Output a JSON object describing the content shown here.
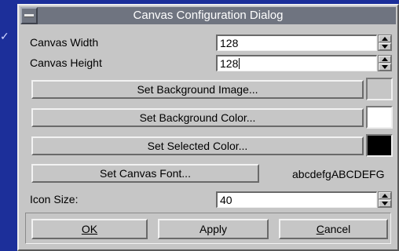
{
  "dialog": {
    "title": "Canvas Configuration Dialog"
  },
  "fields": {
    "width": {
      "label": "Canvas Width",
      "value": "128"
    },
    "height": {
      "label": "Canvas Height",
      "value": "128"
    },
    "icon_size": {
      "label": "Icon Size:",
      "value": "40"
    }
  },
  "buttons": {
    "background_image": "Set Background Image...",
    "background_color": "Set Background Color...",
    "selected_color": "Set Selected Color...",
    "canvas_font": "Set Canvas Font...",
    "ok": "OK",
    "apply": "Apply",
    "cancel": "Cancel"
  },
  "swatches": {
    "background_image": "#c6c6c6",
    "background_color": "#ffffff",
    "selected_color": "#000000"
  },
  "font_sample": "abcdefgABCDEFG",
  "colors": {
    "desktop": "#1c2f9a",
    "titlebar": "#6f7480",
    "dialog": "#c6c6c6"
  }
}
